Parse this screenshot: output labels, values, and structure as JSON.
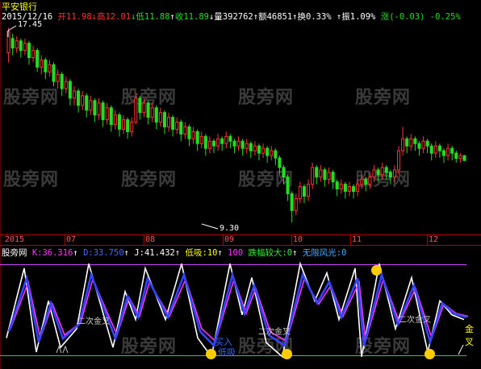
{
  "stock_name": "平安银行",
  "quote": {
    "date": "2015/12/16",
    "open_label": "开",
    "open": "11.98",
    "high_label": "高",
    "high": "12.01",
    "low_label": "低",
    "low": "11.88",
    "close_label": "收",
    "close": "11.89",
    "volume_label": "量",
    "volume": "392762",
    "amount_label": "额",
    "amount": "46851",
    "turnover_label": "换",
    "turnover": "0.33%",
    "amplitude_label": "振",
    "amplitude": "1.09%",
    "change_label": "涨",
    "change": "(-0.03)",
    "change_pct": "-0.25%"
  },
  "price_panel": {
    "high_marker": "17.45",
    "low_marker": "9.30",
    "watermark": "股旁网"
  },
  "x_axis": {
    "labels": [
      "2015",
      "07",
      "08",
      "09",
      "10",
      "11",
      "12"
    ]
  },
  "indicator": {
    "name": "股旁网",
    "k": "K:36.316",
    "d": "D:33.750",
    "j": "J:41.432",
    "low_buy": "低吸:10",
    "level_100": "100",
    "oversold": "跌幅较大:0",
    "bright": "无限风光:0",
    "annotations": {
      "second_cross_1": "二次金叉",
      "second_cross_2": "二次金叉",
      "second_cross_3": "二次金叉",
      "buy_1": "买入",
      "buy_2": "低吸",
      "gold": "金叉"
    }
  },
  "colors": {
    "up": "#ff3333",
    "down": "#22dd22",
    "k_line": "#ffffff",
    "d_line": "#ff33ff",
    "j_line": "#3344ff",
    "level_top": "#cc44ff",
    "level_bottom": "#33cc33",
    "axis": "#b00000"
  },
  "chart_data": {
    "type": "candlestick",
    "title": "平安银行",
    "y_max_marker": 17.45,
    "y_min_marker": 9.3,
    "candles": [
      [
        16.4,
        17.3,
        17.45,
        16.0
      ],
      [
        17.0,
        16.6,
        17.2,
        16.3
      ],
      [
        16.6,
        16.9,
        17.1,
        16.4
      ],
      [
        16.9,
        16.5,
        17.0,
        16.2
      ],
      [
        16.5,
        16.8,
        17.0,
        16.3
      ],
      [
        16.8,
        16.2,
        16.9,
        15.9
      ],
      [
        16.2,
        16.5,
        16.7,
        16.0
      ],
      [
        16.5,
        15.8,
        16.6,
        15.6
      ],
      [
        15.8,
        16.1,
        16.3,
        15.5
      ],
      [
        16.1,
        15.6,
        16.2,
        15.3
      ],
      [
        15.6,
        15.9,
        16.1,
        15.4
      ],
      [
        15.9,
        15.2,
        16.0,
        15.0
      ],
      [
        15.2,
        15.5,
        15.7,
        14.9
      ],
      [
        15.5,
        14.9,
        15.6,
        14.6
      ],
      [
        14.9,
        15.2,
        15.4,
        14.7
      ],
      [
        15.2,
        14.5,
        15.3,
        14.2
      ],
      [
        14.5,
        14.8,
        15.0,
        14.2
      ],
      [
        14.8,
        14.2,
        14.9,
        13.9
      ],
      [
        14.2,
        14.6,
        14.8,
        14.0
      ],
      [
        14.6,
        14.0,
        14.7,
        13.7
      ],
      [
        14.0,
        14.4,
        14.6,
        13.8
      ],
      [
        14.4,
        13.8,
        14.5,
        13.5
      ],
      [
        13.8,
        14.3,
        14.5,
        13.6
      ],
      [
        14.3,
        13.6,
        14.4,
        13.3
      ],
      [
        13.6,
        14.1,
        14.3,
        13.4
      ],
      [
        14.1,
        13.4,
        14.2,
        13.1
      ],
      [
        13.4,
        13.8,
        14.0,
        13.2
      ],
      [
        13.8,
        13.2,
        13.9,
        12.9
      ],
      [
        13.2,
        13.6,
        13.8,
        13.0
      ],
      [
        13.6,
        13.1,
        13.7,
        12.8
      ],
      [
        13.1,
        13.5,
        13.7,
        12.9
      ],
      [
        13.5,
        14.5,
        14.7,
        13.4
      ],
      [
        14.5,
        13.9,
        14.6,
        13.6
      ],
      [
        13.9,
        14.3,
        14.5,
        13.7
      ],
      [
        14.3,
        13.7,
        14.4,
        13.4
      ],
      [
        13.7,
        14.1,
        14.3,
        13.5
      ],
      [
        14.1,
        13.5,
        14.2,
        13.2
      ],
      [
        13.5,
        13.9,
        14.1,
        13.3
      ],
      [
        13.9,
        13.3,
        14.0,
        13.0
      ],
      [
        13.3,
        13.7,
        13.9,
        13.1
      ],
      [
        13.7,
        13.2,
        13.8,
        12.9
      ],
      [
        13.2,
        13.5,
        13.7,
        13.0
      ],
      [
        13.5,
        13.0,
        13.6,
        12.7
      ],
      [
        13.0,
        13.3,
        13.5,
        12.8
      ],
      [
        13.3,
        12.8,
        13.4,
        12.5
      ],
      [
        12.8,
        13.1,
        13.3,
        12.6
      ],
      [
        13.1,
        12.6,
        13.2,
        12.3
      ],
      [
        12.6,
        12.9,
        13.1,
        12.4
      ],
      [
        12.9,
        12.4,
        13.0,
        12.1
      ],
      [
        12.4,
        12.7,
        12.9,
        12.2
      ],
      [
        12.7,
        12.5,
        12.8,
        12.2
      ],
      [
        12.5,
        12.8,
        13.0,
        12.3
      ],
      [
        12.8,
        12.6,
        12.9,
        12.3
      ],
      [
        12.6,
        12.9,
        13.1,
        12.4
      ],
      [
        12.9,
        12.7,
        13.0,
        12.4
      ],
      [
        12.7,
        12.5,
        12.8,
        12.2
      ],
      [
        12.5,
        12.7,
        12.9,
        12.3
      ],
      [
        12.7,
        12.4,
        12.8,
        12.1
      ],
      [
        12.4,
        12.6,
        12.8,
        12.2
      ],
      [
        12.6,
        12.3,
        12.7,
        12.0
      ],
      [
        12.3,
        12.5,
        12.7,
        12.1
      ],
      [
        12.5,
        12.2,
        12.6,
        11.9
      ],
      [
        12.2,
        12.4,
        12.6,
        12.0
      ],
      [
        12.4,
        12.1,
        12.5,
        11.8
      ],
      [
        12.1,
        12.3,
        12.5,
        11.9
      ],
      [
        12.3,
        12.0,
        12.4,
        11.7
      ],
      [
        12.0,
        11.6,
        12.1,
        11.3
      ],
      [
        11.6,
        11.2,
        11.7,
        10.9
      ],
      [
        11.2,
        10.5,
        11.3,
        10.2
      ],
      [
        10.5,
        9.8,
        10.6,
        9.3
      ],
      [
        9.8,
        10.3,
        10.5,
        9.6
      ],
      [
        10.3,
        10.8,
        11.0,
        10.1
      ],
      [
        10.8,
        10.4,
        10.9,
        10.1
      ],
      [
        10.4,
        10.9,
        11.1,
        10.2
      ],
      [
        10.9,
        11.6,
        11.8,
        10.7
      ],
      [
        11.6,
        11.2,
        11.7,
        10.9
      ],
      [
        11.2,
        11.5,
        11.7,
        11.0
      ],
      [
        11.5,
        11.1,
        11.6,
        10.8
      ],
      [
        11.1,
        11.4,
        11.6,
        10.9
      ],
      [
        11.4,
        11.0,
        11.5,
        10.7
      ],
      [
        11.0,
        10.7,
        11.1,
        10.4
      ],
      [
        10.7,
        10.9,
        11.1,
        10.5
      ],
      [
        10.9,
        10.6,
        11.0,
        10.3
      ],
      [
        10.6,
        10.8,
        11.0,
        10.4
      ],
      [
        10.8,
        10.6,
        10.9,
        10.3
      ],
      [
        10.6,
        10.9,
        11.1,
        10.4
      ],
      [
        10.9,
        11.1,
        11.3,
        10.7
      ],
      [
        11.1,
        10.9,
        11.2,
        10.6
      ],
      [
        10.9,
        11.2,
        11.4,
        10.7
      ],
      [
        11.2,
        11.5,
        11.7,
        11.0
      ],
      [
        11.5,
        11.3,
        11.6,
        11.0
      ],
      [
        11.3,
        11.6,
        11.8,
        11.1
      ],
      [
        11.6,
        11.4,
        11.7,
        11.1
      ],
      [
        11.4,
        11.2,
        11.5,
        10.9
      ],
      [
        11.2,
        11.5,
        11.7,
        11.0
      ],
      [
        11.5,
        12.3,
        12.5,
        11.3
      ],
      [
        12.3,
        12.8,
        13.3,
        12.1
      ],
      [
        12.8,
        12.5,
        12.9,
        12.2
      ],
      [
        12.5,
        12.8,
        13.0,
        12.3
      ],
      [
        12.8,
        12.6,
        12.9,
        12.3
      ],
      [
        12.6,
        12.4,
        12.7,
        12.1
      ],
      [
        12.4,
        12.7,
        12.9,
        12.2
      ],
      [
        12.7,
        12.5,
        12.8,
        12.2
      ],
      [
        12.5,
        12.2,
        12.6,
        11.9
      ],
      [
        12.2,
        12.5,
        12.7,
        12.0
      ],
      [
        12.5,
        12.3,
        12.6,
        12.0
      ],
      [
        12.3,
        12.1,
        12.4,
        11.8
      ],
      [
        12.1,
        12.4,
        12.6,
        11.9
      ],
      [
        12.4,
        12.2,
        12.5,
        11.9
      ],
      [
        12.2,
        11.98,
        12.3,
        11.8
      ],
      [
        11.98,
        12.1,
        12.2,
        11.8
      ],
      [
        12.1,
        11.89,
        12.01,
        11.88
      ]
    ]
  }
}
